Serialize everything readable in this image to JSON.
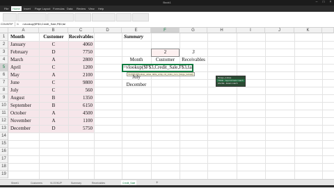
{
  "window": {
    "title": "Book1"
  },
  "ribbon_tabs": [
    "File",
    "Home",
    "Insert",
    "Page Layout",
    "Formulas",
    "Data",
    "Review",
    "View",
    "Help"
  ],
  "formula_bar": {
    "name_box": "COUNTIF",
    "fx": "fx",
    "formula": "=vlookup($F$3,Credit_Sale,F$3,fal"
  },
  "columns": [
    "A",
    "B",
    "C",
    "D",
    "E",
    "F",
    "G",
    "H",
    "I",
    "J",
    "K"
  ],
  "rows": [
    "1",
    "2",
    "3",
    "4",
    "5",
    "6",
    "7",
    "8",
    "9",
    "10",
    "11",
    "12",
    "13",
    "14",
    "15",
    "16",
    "17",
    "18",
    "19"
  ],
  "table": {
    "headers": {
      "month": "Month",
      "customer": "Customer",
      "receivables": "Receivables"
    },
    "rows": [
      {
        "month": "January",
        "customer": "C",
        "receivables": "4060"
      },
      {
        "month": "February",
        "customer": "D",
        "receivables": "7750"
      },
      {
        "month": "March",
        "customer": "A",
        "receivables": "2800"
      },
      {
        "month": "April",
        "customer": "C",
        "receivables": "1200"
      },
      {
        "month": "May",
        "customer": "A",
        "receivables": "2100"
      },
      {
        "month": "June",
        "customer": "C",
        "receivables": "9800"
      },
      {
        "month": "July",
        "customer": "C",
        "receivables": "560"
      },
      {
        "month": "August",
        "customer": "B",
        "receivables": "1350"
      },
      {
        "month": "September",
        "customer": "B",
        "receivables": "6150"
      },
      {
        "month": "October",
        "customer": "A",
        "receivables": "4500"
      },
      {
        "month": "November",
        "customer": "A",
        "receivables": "1100"
      },
      {
        "month": "December",
        "customer": "D",
        "receivables": "5750"
      }
    ]
  },
  "summary": {
    "title": "Summary",
    "f3": "2",
    "g3": "3",
    "headers": {
      "month": "Month",
      "customer": "Customer",
      "receivables": "Receivables"
    },
    "active_formula": "=vlookup($F$3,Credit_Sale,F$3,fal",
    "tooltip": "VLOOKUP(lookup_value, table_array, col_index_num, [range_lookup])",
    "e7": "July",
    "e8": "December"
  },
  "autocomplete": [
    {
      "label": "Range_lookup"
    },
    {
      "label": "TRUE - Approximate match"
    },
    {
      "label": "FALSE - Exact match"
    }
  ],
  "sheet_tabs": [
    "Sheet1",
    "Customers",
    "VLOOKUP",
    "Summary",
    "Receivables",
    "Credit_Sale"
  ],
  "active_sheet_index": 5
}
